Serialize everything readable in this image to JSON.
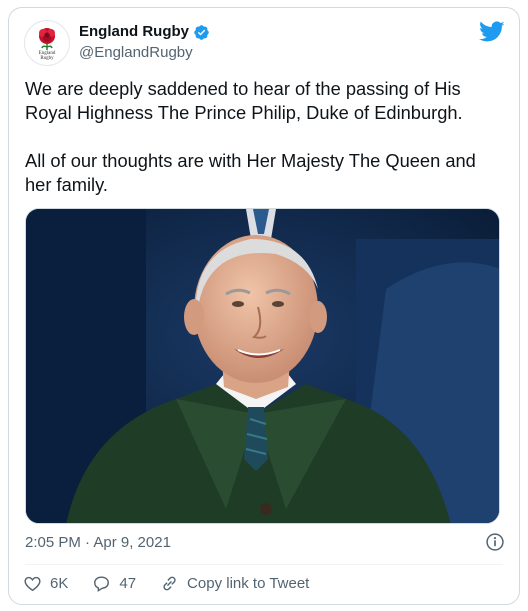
{
  "author": {
    "display_name": "England Rugby",
    "handle": "@EnglandRugby",
    "avatar_text": [
      "England",
      "Rugby"
    ],
    "verified_color": "#1d9bf0"
  },
  "tweet": {
    "paragraphs": [
      "We are deeply saddened to hear of the passing of His Royal Highness The Prince Philip, Duke of Edinburgh.",
      "All of our thoughts are with Her Majesty The Queen and her family."
    ],
    "timestamp": "2:05 PM · Apr 9, 2021"
  },
  "actions": {
    "likes": "6K",
    "replies": "47",
    "copy_link_label": "Copy link to Tweet"
  },
  "colors": {
    "brand_blue": "#1d9bf0",
    "secondary_text": "#536471",
    "rose_red": "#c8102e"
  },
  "icons": [
    "twitter-bird-icon",
    "verified-badge-icon",
    "info-icon",
    "heart-icon",
    "reply-icon",
    "link-icon",
    "england-rose-icon"
  ]
}
